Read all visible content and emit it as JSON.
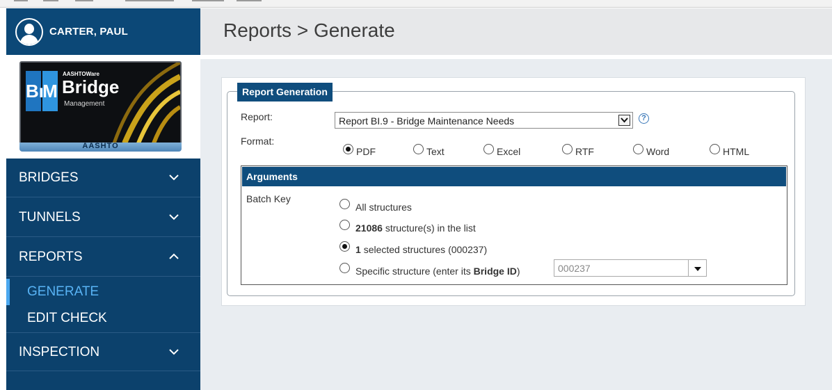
{
  "user": {
    "name": "CARTER, PAUL"
  },
  "logo": {
    "line1": "AASHTOWare",
    "line2": "Bridge",
    "line3": "Management",
    "br": "Br",
    "m": "M",
    "footer": "AASHTO"
  },
  "nav": {
    "bridges": "BRIDGES",
    "tunnels": "TUNNELS",
    "reports": "REPORTS",
    "generate": "GENERATE",
    "edit_check": "EDIT CHECK",
    "inspection": "INSPECTION"
  },
  "page": {
    "title": "Reports > Generate"
  },
  "form": {
    "legend": "Report Generation",
    "report_label": "Report:",
    "report_value": "Report BI.9 - Bridge Maintenance Needs",
    "format_label": "Format:",
    "formats": [
      "PDF",
      "Text",
      "Excel",
      "RTF",
      "Word",
      "HTML"
    ],
    "selected_format": "PDF",
    "help_symbol": "?"
  },
  "arguments": {
    "header": "Arguments",
    "batch_key_label": "Batch Key",
    "opt_all": "All structures",
    "opt_list_count": "21086",
    "opt_list_suffix": "structure(s) in the list",
    "opt_selected_count": "1",
    "opt_selected_suffix": "selected structures (000237)",
    "opt_specific_prefix": "Specific structure (enter its ",
    "opt_specific_bold": "Bridge ID",
    "opt_specific_suffix": ")",
    "selected_option": "selected",
    "bridge_id_placeholder": "000237"
  },
  "colors": {
    "sidebar": "#0c416c",
    "header_bar": "#0f4d7d",
    "active_nav": "#58b3f5"
  }
}
